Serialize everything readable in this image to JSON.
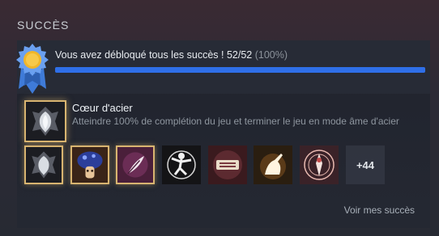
{
  "section": {
    "title": "SUCCÈS"
  },
  "progress": {
    "label": "Vous avez débloqué tous les succès ! 52/52",
    "percent_label": "(100%)",
    "fraction": 1.0,
    "medal_icon": "ribbon-medal-icon",
    "bar_color": "#2f6fe8"
  },
  "featured": {
    "title": "Cœur d'acier",
    "description": "Atteindre 100% de complétion du jeu et terminer le jeu en mode âme d'acier",
    "icon": "steel-heart-icon"
  },
  "achievements": [
    {
      "icon": "steel-heart-icon",
      "gold": true
    },
    {
      "icon": "mushroom-icon",
      "gold": true
    },
    {
      "icon": "feather-icon",
      "gold": true
    },
    {
      "icon": "dancer-icon",
      "gold": false
    },
    {
      "icon": "scroll-icon",
      "gold": false
    },
    {
      "icon": "warrior-silhouette-icon",
      "gold": false
    },
    {
      "icon": "shrine-figure-icon",
      "gold": false
    }
  ],
  "more": {
    "label": "+44"
  },
  "view_link": {
    "label": "Voir mes succès"
  },
  "colors": {
    "accent_gold": "#d8b470",
    "accent_blue": "#2f6fe8"
  }
}
